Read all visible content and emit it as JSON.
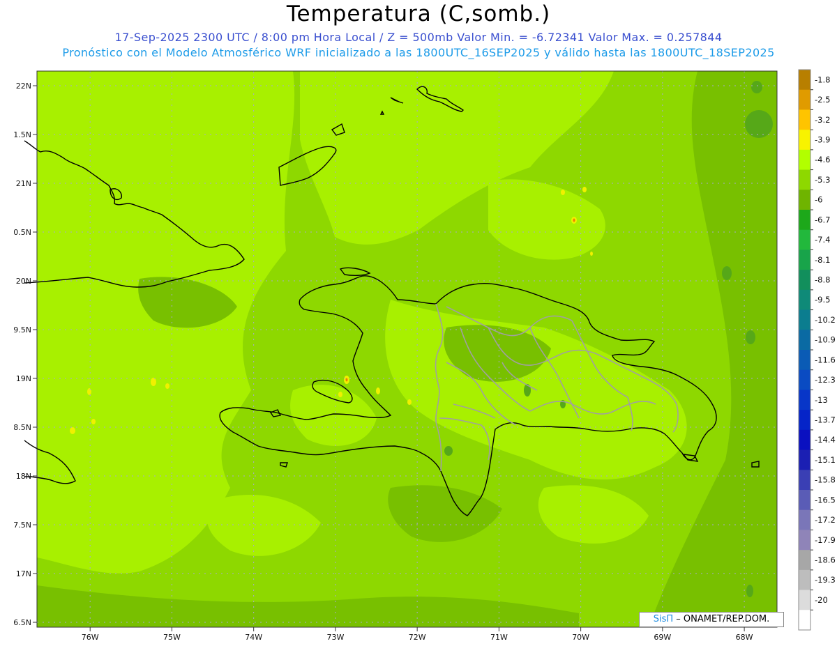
{
  "header": {
    "title": "Temperatura (C,somb.)",
    "line1": "17-Sep-2025  2300 UTC / 8:00 pm Hora Local / Z = 500mb  Valor Min. = -6.72341  Valor Max. = 0.257844",
    "line2": "Pronóstico con el Modelo Atmosférico WRF inicializado a las 1800UTC_16SEP2025 y válido hasta las  1800UTC_18SEP2025"
  },
  "credit": {
    "brand": "SisΠ",
    "text": " – ONAMET/REP.DOM."
  },
  "axes": {
    "lat_labels": [
      "22N",
      "1.5N",
      "21N",
      "0.5N",
      "20N",
      "9.5N",
      "19N",
      "8.5N",
      "18N",
      "7.5N",
      "17N",
      "6.5N"
    ],
    "lon_labels": [
      "76W",
      "75W",
      "74W",
      "73W",
      "72W",
      "71W",
      "70W",
      "69W",
      "68W"
    ],
    "lat_range": [
      16.4,
      22.1
    ],
    "lon_range": [
      -76.65,
      -67.6
    ]
  },
  "colorbar": {
    "labels": [
      "-1.8",
      "-2.5",
      "-3.2",
      "-3.9",
      "-4.6",
      "-5.3",
      "-6",
      "-6.7",
      "-7.4",
      "-8.1",
      "-8.8",
      "-9.5",
      "-10.2",
      "-10.9",
      "-11.6",
      "-12.3",
      "-13",
      "-13.7",
      "-14.4",
      "-15.1",
      "-15.8",
      "-16.5",
      "-17.2",
      "-17.9",
      "-18.6",
      "-19.3",
      "-20"
    ],
    "colors": [
      "#b87f00",
      "#e09b00",
      "#ffc400",
      "#f8f300",
      "#b2ff00",
      "#8ed800",
      "#6fb400",
      "#1da81a",
      "#22b83c",
      "#18a44a",
      "#128f5c",
      "#0f8a78",
      "#0b7d8f",
      "#0a6aa3",
      "#0a5bb5",
      "#0a4bc2",
      "#0836c8",
      "#0524c8",
      "#0a10c0",
      "#1b1fb3",
      "#3a3fb4",
      "#5a5cb6",
      "#7a76b8",
      "#8f84b8",
      "#a7a7a7",
      "#bdbdbd",
      "#dcdcdc",
      "#ffffff"
    ]
  },
  "colors": {
    "base_field": "#8ed800",
    "light_field": "#a8f000",
    "dark_field": "#78c000",
    "coast": "#000000",
    "borders": "#a0a0a0"
  }
}
